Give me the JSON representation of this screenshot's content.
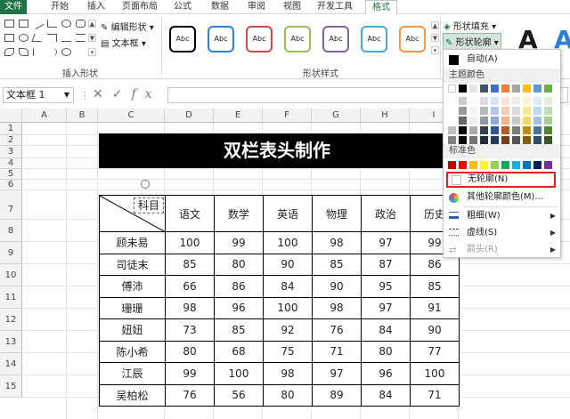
{
  "tabs": [
    "文件",
    "开始",
    "插入",
    "页面布局",
    "公式",
    "数据",
    "审阅",
    "视图",
    "开发工具",
    "格式"
  ],
  "ribbon": {
    "edit_shape": "编辑形状",
    "text_box": "文本框",
    "insert_shapes_label": "插入形状",
    "shape_styles_label": "形状样式",
    "abc": "Abc",
    "shape_fill": "形状填充",
    "shape_outline": "形状轮廓",
    "wordart_a": "A"
  },
  "style_colors": [
    "#000000",
    "#2f7fd8",
    "#c0504d",
    "#9bbb59",
    "#8064a2",
    "#4bacc6",
    "#f79646"
  ],
  "formula_bar": {
    "name_box": "文本框 1",
    "fx": "fx",
    "value": ""
  },
  "columns": [
    "A",
    "B",
    "C",
    "D",
    "E",
    "F",
    "G",
    "H",
    "I"
  ],
  "rows": [
    "1",
    "2",
    "3",
    "4",
    "5",
    "6",
    "7",
    "8",
    "9",
    "10",
    "11",
    "12",
    "13",
    "14",
    "15"
  ],
  "sheet": {
    "title": "双栏表头制作",
    "corner_label": "科目",
    "subjects": [
      "语文",
      "数学",
      "英语",
      "物理",
      "政治",
      "历史"
    ],
    "students": [
      {
        "name": "顾未易",
        "scores": [
          "100",
          "99",
          "100",
          "98",
          "97",
          "99"
        ]
      },
      {
        "name": "司徒末",
        "scores": [
          "85",
          "80",
          "90",
          "85",
          "87",
          "86"
        ]
      },
      {
        "name": "傅沛",
        "scores": [
          "66",
          "86",
          "84",
          "90",
          "95",
          "85"
        ]
      },
      {
        "name": "珊珊",
        "scores": [
          "98",
          "96",
          "100",
          "98",
          "97",
          "91"
        ]
      },
      {
        "name": "妞妞",
        "scores": [
          "73",
          "85",
          "92",
          "76",
          "84",
          "90"
        ]
      },
      {
        "name": "陈小希",
        "scores": [
          "80",
          "68",
          "75",
          "71",
          "80",
          "77"
        ]
      },
      {
        "name": "江辰",
        "scores": [
          "99",
          "100",
          "98",
          "97",
          "96",
          "100"
        ]
      },
      {
        "name": "吴柏松",
        "scores": [
          "76",
          "56",
          "80",
          "89",
          "84",
          "71"
        ]
      }
    ]
  },
  "menu": {
    "auto": "自动(A)",
    "theme_colors": "主题颜色",
    "standard_colors": "标准色",
    "no_outline": "无轮廓(N)",
    "more_colors": "其他轮廓颜色(M)...",
    "weight": "粗细(W)",
    "dashes": "虚线(S)",
    "arrows": "箭头(R)",
    "theme_top": [
      "#ffffff",
      "#000000",
      "#e7e6e6",
      "#44546a",
      "#4472c4",
      "#ed7d31",
      "#a5a5a5",
      "#ffc000",
      "#5b9bd5",
      "#70ad47",
      "#7f7f7f",
      "#7030a0",
      "#f79646"
    ],
    "standard": [
      "#c00000",
      "#ff0000",
      "#ffc000",
      "#ffff00",
      "#92d050",
      "#00b050",
      "#00b0f0",
      "#0070c0",
      "#002060",
      "#7030a0"
    ]
  },
  "colors": {
    "excel_green": "#217346",
    "highlight_red": "#e02020",
    "title_band": "#000000"
  }
}
